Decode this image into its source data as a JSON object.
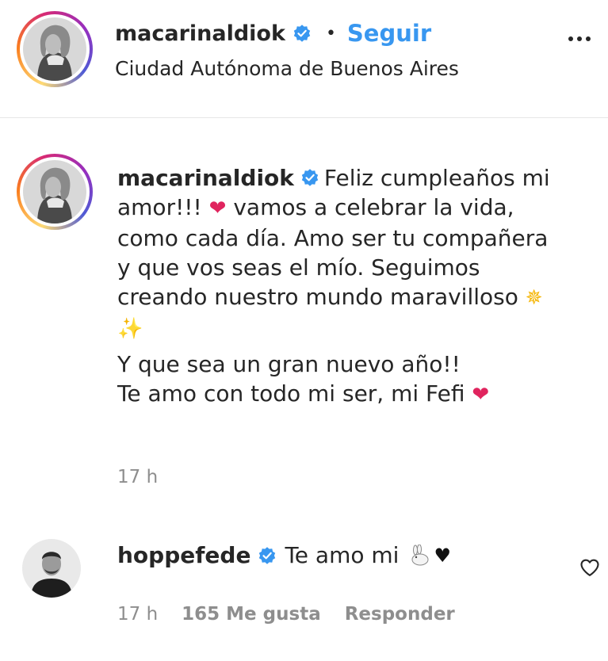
{
  "header": {
    "username": "macarinaldiok",
    "separator": "•",
    "follow_label": "Seguir",
    "location": "Ciudad Autónoma de Buenos Aires"
  },
  "caption": {
    "username": "macarinaldiok",
    "line1": "Feliz cumpleaños mi",
    "line2a": "amor!!!",
    "line2b": "vamos a celebrar la vida,",
    "line3": "como cada día. Amo ser tu compañera",
    "line4": "y que vos seas el mío. Seguimos",
    "line5": "creando nuestro mundo maravilloso",
    "line6": "Y que sea un gran nuevo año!!",
    "line7": "Te amo con todo mi ser, mi Fefi",
    "timestamp": "17 h"
  },
  "comment": {
    "username": "hoppefede",
    "text": "Te amo mi",
    "timestamp": "17 h",
    "likes": "165 Me gusta",
    "reply_label": "Responder"
  },
  "colors": {
    "accent": "#3897f0",
    "text": "#262626",
    "muted": "#8e8e8e",
    "verified": "#3897f0",
    "heart": "#e0245e"
  },
  "icons": {
    "verified": "verified-badge-icon",
    "more": "more-options-icon",
    "like": "heart-outline-icon",
    "emoji_heart": "red-heart-emoji",
    "emoji_dizzy": "dizzy-star-emoji",
    "emoji_sparkles": "sparkles-emoji",
    "emoji_rabbit": "rabbit-emoji",
    "emoji_black_heart": "black-heart-emoji"
  }
}
